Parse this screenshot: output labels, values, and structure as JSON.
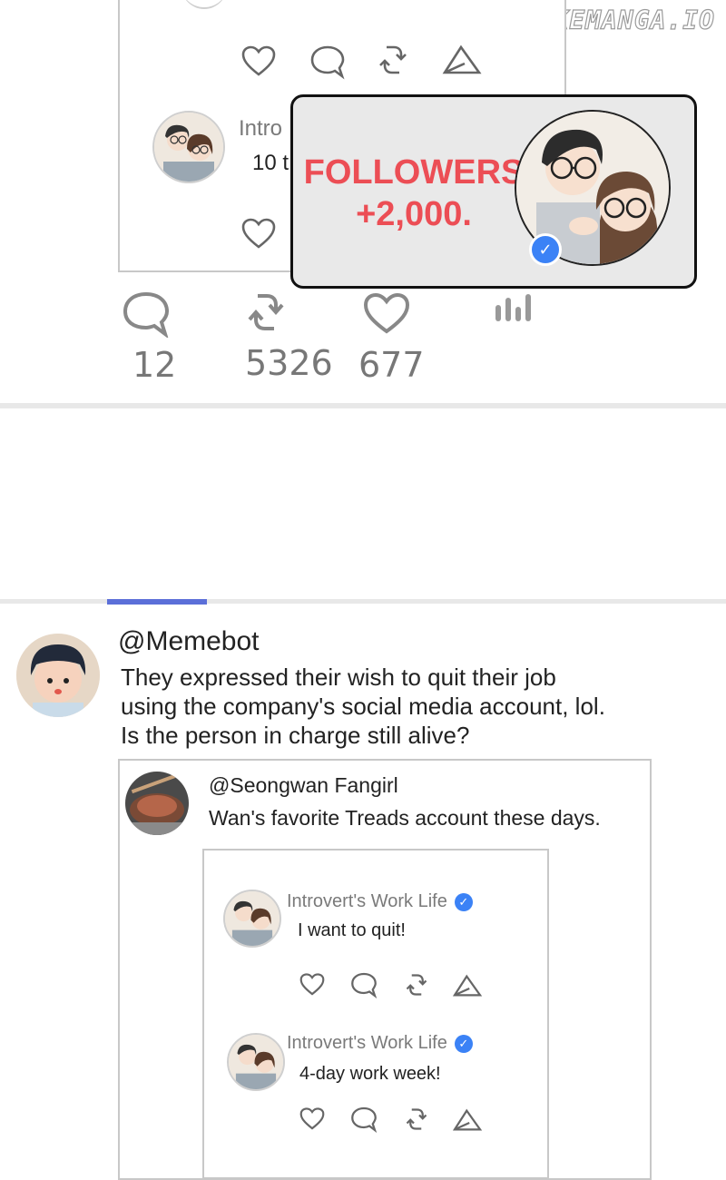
{
  "watermark": "LIKEMANGA.IO",
  "top_quote": {
    "inner_name_partial": "Intro",
    "inner_text_partial": "10 t"
  },
  "popup": {
    "line1": "FOLLOWERS",
    "line2": "+2,000.",
    "verified_badge": "check-icon"
  },
  "stats": {
    "comments": "12",
    "reposts": "5326",
    "likes": "677"
  },
  "post": {
    "handle": "@Memebot",
    "text_lines": [
      "They expressed their wish to quit their job",
      "using the company's social media account, lol.",
      "Is the person in charge still alive?"
    ],
    "quote": {
      "handle": "@Seongwan Fangirl",
      "text": "Wan's favorite Treads account these days.",
      "inner_posts": [
        {
          "name": "Introvert's Work Life",
          "text": "I want to quit!"
        },
        {
          "name": "Introvert's Work Life",
          "text": "4-day work week!"
        }
      ]
    }
  },
  "colors": {
    "accent_tab": "#5b6fd8",
    "popup_text": "#ec4e55",
    "verified": "#3b82f6"
  }
}
